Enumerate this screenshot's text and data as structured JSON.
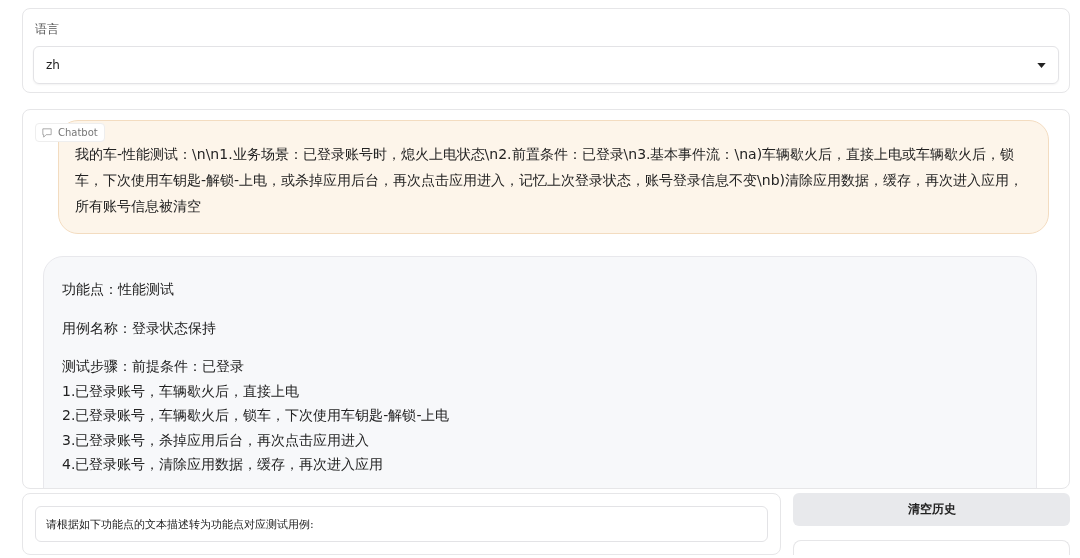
{
  "language": {
    "label": "语言",
    "value": "zh"
  },
  "chatbot": {
    "label": "Chatbot",
    "messages": [
      {
        "kind": "user",
        "lines": [
          "我的车-性能测试：\\n\\n1.业务场景：已登录账号时，熄火上电状态\\n2.前置条件：已登录\\n3.基本事件流：\\na)车辆歇火后，直接上电或车辆歇火后，锁车，下次使用车钥匙-解锁-上电，或杀掉应用后台，再次点击应用进入，记忆上次登录状态，账号登录信息不变\\nb)清除应用数据，缓存，再次进入应用，所有账号信息被清空"
        ]
      },
      {
        "kind": "bot",
        "paragraphs": [
          [
            "功能点：性能测试"
          ],
          [
            "用例名称：登录状态保持"
          ],
          [
            "测试步骤：前提条件：已登录",
            "1.已登录账号，车辆歇火后，直接上电",
            "2.已登录账号，车辆歇火后，锁车，下次使用车钥匙-解锁-上电",
            "3.已登录账号，杀掉应用后台，再次点击应用进入",
            "4.已登录账号，清除应用数据，缓存，再次进入应用"
          ]
        ]
      }
    ]
  },
  "input": {
    "value": "请根据如下功能点的文本描述转为功能点对应测试用例:"
  },
  "buttons": [
    "清空历史"
  ]
}
